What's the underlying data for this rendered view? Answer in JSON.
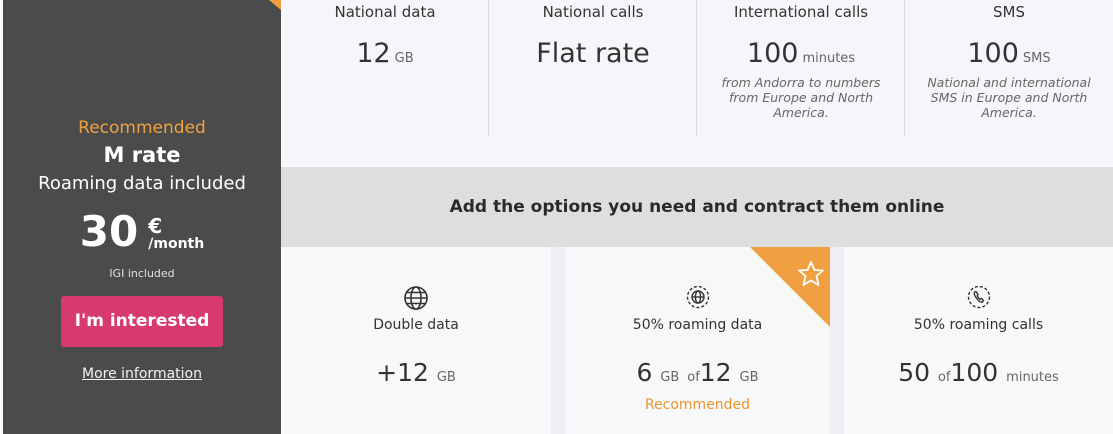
{
  "plan": {
    "recommended_tag": "Recommended",
    "name": "M rate",
    "subtitle": "Roaming data included",
    "price": "30",
    "currency": "€",
    "period": "/month",
    "tax_note": "IGI included",
    "cta_label": "I'm interested",
    "more_info": "More information"
  },
  "features": [
    {
      "title": "National data",
      "value": "12",
      "unit": "GB",
      "note": ""
    },
    {
      "title": "National calls",
      "value": "Flat rate",
      "unit": "",
      "note": ""
    },
    {
      "title": "International calls",
      "value": "100",
      "unit": "minutes",
      "note": "from Andorra to numbers from Europe and North America."
    },
    {
      "title": "SMS",
      "value": "100",
      "unit": "SMS",
      "note": "National and international SMS in Europe and North America."
    }
  ],
  "options_banner": "Add the options you need and contract them online",
  "options": [
    {
      "icon": "globe-icon",
      "title": "Double data",
      "value_prefix": "+12",
      "value_unit": "GB"
    },
    {
      "icon": "roaming-data-icon",
      "title": "50% roaming data",
      "value": "6",
      "value_unit": "GB",
      "of": "of",
      "total": "12",
      "total_unit": "GB",
      "recommended": "Recommended",
      "ribbon_icon": "star-icon"
    },
    {
      "icon": "phone-call-icon",
      "title": "50% roaming calls",
      "value": "50",
      "of": "of",
      "total": "100",
      "total_unit": "minutes"
    }
  ],
  "colors": {
    "accent_orange": "#f0a040",
    "cta_pink": "#d63a6e",
    "panel_dark": "#4b4b4b"
  }
}
